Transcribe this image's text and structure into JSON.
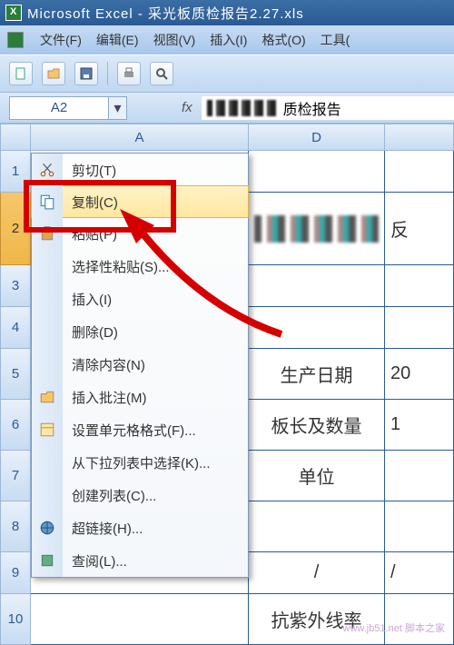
{
  "app": {
    "title": "Microsoft Excel - 采光板质检报告2.27.xls"
  },
  "menu": {
    "file": "文件(F)",
    "edit": "编辑(E)",
    "view": "视图(V)",
    "insert": "插入(I)",
    "format": "格式(O)",
    "tools": "工具("
  },
  "formula_bar": {
    "name_box": "A2",
    "fx_label": "fx",
    "fx_text_suffix": "质检报告"
  },
  "columns": {
    "a": "A",
    "d": "D",
    "e": ""
  },
  "row_headers": [
    "1",
    "2",
    "3",
    "4",
    "5",
    "6",
    "7",
    "8",
    "9",
    "10"
  ],
  "cells": {
    "r2_suffix": "反",
    "r5_d": "生产日期",
    "r5_e": "20",
    "r6_d": "板长及数量",
    "r6_e": "1",
    "r7_d": "单位",
    "r7_e": "",
    "r9_d": "/",
    "r9_e": "/",
    "r10_d": "抗紫外线率",
    "r10_e": ""
  },
  "context_menu": {
    "cut": "剪切(T)",
    "copy": "复制(C)",
    "paste": "粘贴(P)",
    "paste_special": "选择性粘贴(S)...",
    "insert": "插入(I)",
    "delete": "删除(D)",
    "clear": "清除内容(N)",
    "insert_comment": "插入批注(M)",
    "format_cells": "设置单元格格式(F)...",
    "pick_list": "从下拉列表中选择(K)...",
    "create_list": "创建列表(C)...",
    "hyperlink": "超链接(H)...",
    "lookup": "查阅(L)..."
  },
  "watermark": "www.jb51.net 脚本之家"
}
